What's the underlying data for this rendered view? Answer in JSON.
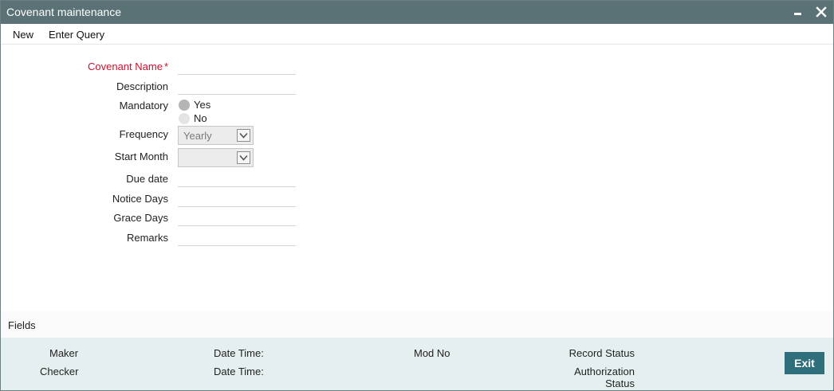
{
  "window": {
    "title": "Covenant maintenance"
  },
  "toolbar": {
    "new_label": "New",
    "enter_query_label": "Enter Query"
  },
  "form": {
    "covenant_name": {
      "label": "Covenant Name",
      "required_mark": "*",
      "value": ""
    },
    "description": {
      "label": "Description",
      "value": ""
    },
    "mandatory": {
      "label": "Mandatory",
      "options": [
        "Yes",
        "No"
      ]
    },
    "frequency": {
      "label": "Frequency",
      "selected": "Yearly"
    },
    "start_month": {
      "label": "Start Month",
      "selected": ""
    },
    "due_date": {
      "label": "Due date",
      "value": ""
    },
    "notice_days": {
      "label": "Notice Days",
      "value": ""
    },
    "grace_days": {
      "label": "Grace Days",
      "value": ""
    },
    "remarks": {
      "label": "Remarks",
      "value": ""
    }
  },
  "fields_bar": {
    "label": "Fields"
  },
  "footer": {
    "maker": "Maker",
    "checker": "Checker",
    "maker_datetime": "Date Time:",
    "checker_datetime": "Date Time:",
    "mod_no": "Mod No",
    "record_status": "Record Status",
    "authorization_status_line1": "Authorization",
    "authorization_status_line2": "Status",
    "exit_label": "Exit"
  },
  "colors": {
    "titlebar": "#5a7275",
    "required_label": "#c8102e",
    "footer_bg": "#e6eff0",
    "exit_button": "#2f6f7c"
  }
}
